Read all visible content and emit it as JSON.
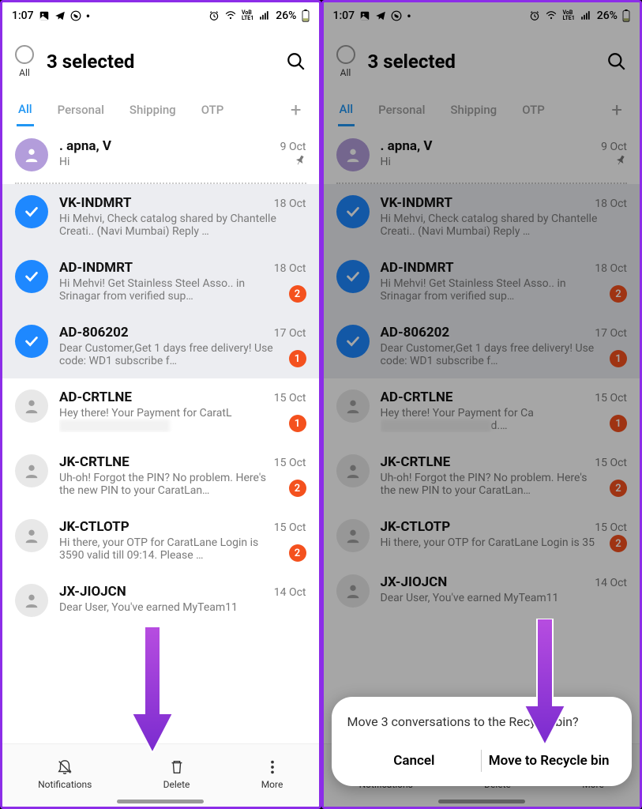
{
  "status": {
    "time": "1:07",
    "battery": "26%"
  },
  "header": {
    "all_label": "All",
    "title": "3 selected"
  },
  "tabs": [
    "All",
    "Personal",
    "Shipping",
    "OTP"
  ],
  "convos": [
    {
      "sender": ". apna, V",
      "date": "9 Oct",
      "preview": "Hi",
      "avatar": "purple",
      "pinned": true,
      "selected": false,
      "badge": null
    },
    {
      "sender": "VK-INDMRT",
      "date": "18 Oct",
      "preview": "Hi Mehvi, Check catalog shared by Chantelle Creati.. (Navi Mumbai)  Reply …",
      "avatar": "check",
      "pinned": false,
      "selected": true,
      "badge": null
    },
    {
      "sender": "AD-INDMRT",
      "date": "18 Oct",
      "preview": "Hi Mehvi! Get Stainless Steel Asso.. in Srinagar from verified sup…",
      "avatar": "check",
      "pinned": false,
      "selected": true,
      "badge": "2"
    },
    {
      "sender": "AD-806202",
      "date": "17 Oct",
      "preview": "Dear Customer,Get 1 days free delivery! Use code: WD1 subscribe f…",
      "avatar": "check",
      "pinned": false,
      "selected": true,
      "badge": "1"
    },
    {
      "sender": "AD-CRTLNE",
      "date": "15 Oct",
      "preview_prefix": "Hey there! Your Payment for CaratL",
      "preview_blur": true,
      "avatar": "grey",
      "pinned": false,
      "selected": false,
      "badge": "1"
    },
    {
      "sender": "JK-CRTLNE",
      "date": "15 Oct",
      "preview": "Uh-oh! Forgot the PIN? No problem. Here's the new PIN to your CaratLan…",
      "avatar": "grey",
      "pinned": false,
      "selected": false,
      "badge": "2"
    },
    {
      "sender": "JK-CTLOTP",
      "date": "15 Oct",
      "preview": "Hi there, your OTP for CaratLane Login is 3590 valid till 09:14. Please …",
      "avatar": "grey",
      "pinned": false,
      "selected": false,
      "badge": "2"
    },
    {
      "sender": "JX-JIOJCN",
      "date": "14 Oct",
      "preview": "Dear User,  You've earned MyTeam11",
      "avatar": "grey",
      "pinned": false,
      "selected": false,
      "badge": null
    }
  ],
  "convos_right_overrides": {
    "4": {
      "preview_prefix": "Hey there! Your Payment for Ca",
      "preview_suffix": "d.…"
    },
    "6": {
      "preview": "Hi there, your OTP for CaratLane Login is 35"
    }
  },
  "bottombar": {
    "notifications": "Notifications",
    "delete": "Delete",
    "more": "More"
  },
  "dialog": {
    "message": "Move 3 conversations to the Recycle bin?",
    "cancel": "Cancel",
    "confirm": "Move to Recycle bin"
  }
}
